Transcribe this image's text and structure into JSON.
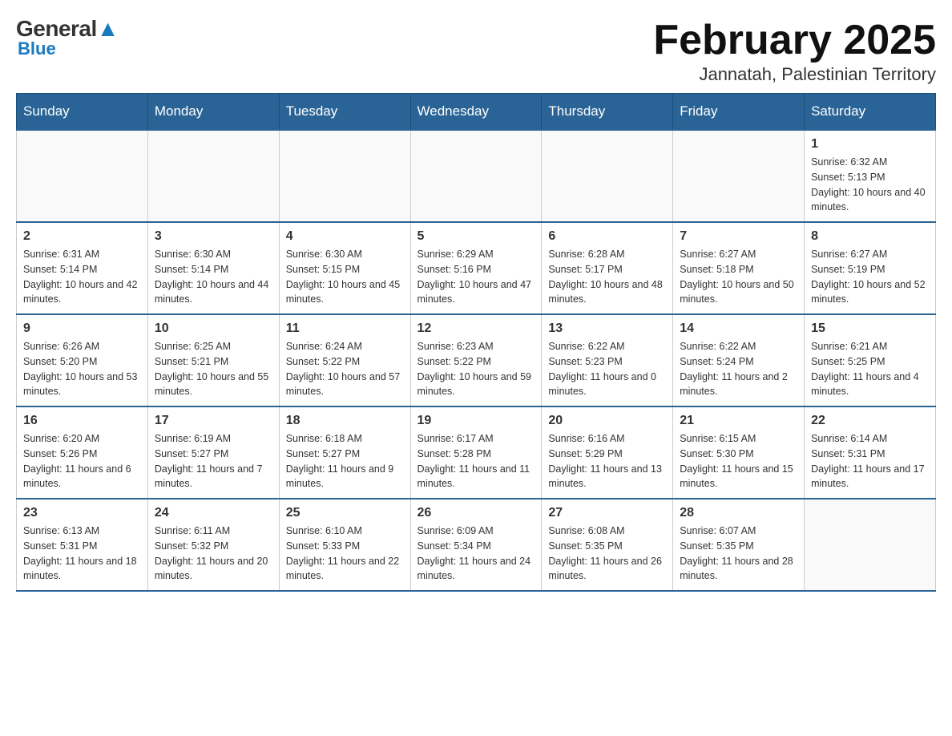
{
  "logo": {
    "general": "General",
    "blue": "Blue",
    "arrow": "▼"
  },
  "header": {
    "month_year": "February 2025",
    "location": "Jannatah, Palestinian Territory"
  },
  "days_of_week": [
    "Sunday",
    "Monday",
    "Tuesday",
    "Wednesday",
    "Thursday",
    "Friday",
    "Saturday"
  ],
  "weeks": [
    [
      {
        "day": "",
        "sunrise": "",
        "sunset": "",
        "daylight": ""
      },
      {
        "day": "",
        "sunrise": "",
        "sunset": "",
        "daylight": ""
      },
      {
        "day": "",
        "sunrise": "",
        "sunset": "",
        "daylight": ""
      },
      {
        "day": "",
        "sunrise": "",
        "sunset": "",
        "daylight": ""
      },
      {
        "day": "",
        "sunrise": "",
        "sunset": "",
        "daylight": ""
      },
      {
        "day": "",
        "sunrise": "",
        "sunset": "",
        "daylight": ""
      },
      {
        "day": "1",
        "sunrise": "Sunrise: 6:32 AM",
        "sunset": "Sunset: 5:13 PM",
        "daylight": "Daylight: 10 hours and 40 minutes."
      }
    ],
    [
      {
        "day": "2",
        "sunrise": "Sunrise: 6:31 AM",
        "sunset": "Sunset: 5:14 PM",
        "daylight": "Daylight: 10 hours and 42 minutes."
      },
      {
        "day": "3",
        "sunrise": "Sunrise: 6:30 AM",
        "sunset": "Sunset: 5:14 PM",
        "daylight": "Daylight: 10 hours and 44 minutes."
      },
      {
        "day": "4",
        "sunrise": "Sunrise: 6:30 AM",
        "sunset": "Sunset: 5:15 PM",
        "daylight": "Daylight: 10 hours and 45 minutes."
      },
      {
        "day": "5",
        "sunrise": "Sunrise: 6:29 AM",
        "sunset": "Sunset: 5:16 PM",
        "daylight": "Daylight: 10 hours and 47 minutes."
      },
      {
        "day": "6",
        "sunrise": "Sunrise: 6:28 AM",
        "sunset": "Sunset: 5:17 PM",
        "daylight": "Daylight: 10 hours and 48 minutes."
      },
      {
        "day": "7",
        "sunrise": "Sunrise: 6:27 AM",
        "sunset": "Sunset: 5:18 PM",
        "daylight": "Daylight: 10 hours and 50 minutes."
      },
      {
        "day": "8",
        "sunrise": "Sunrise: 6:27 AM",
        "sunset": "Sunset: 5:19 PM",
        "daylight": "Daylight: 10 hours and 52 minutes."
      }
    ],
    [
      {
        "day": "9",
        "sunrise": "Sunrise: 6:26 AM",
        "sunset": "Sunset: 5:20 PM",
        "daylight": "Daylight: 10 hours and 53 minutes."
      },
      {
        "day": "10",
        "sunrise": "Sunrise: 6:25 AM",
        "sunset": "Sunset: 5:21 PM",
        "daylight": "Daylight: 10 hours and 55 minutes."
      },
      {
        "day": "11",
        "sunrise": "Sunrise: 6:24 AM",
        "sunset": "Sunset: 5:22 PM",
        "daylight": "Daylight: 10 hours and 57 minutes."
      },
      {
        "day": "12",
        "sunrise": "Sunrise: 6:23 AM",
        "sunset": "Sunset: 5:22 PM",
        "daylight": "Daylight: 10 hours and 59 minutes."
      },
      {
        "day": "13",
        "sunrise": "Sunrise: 6:22 AM",
        "sunset": "Sunset: 5:23 PM",
        "daylight": "Daylight: 11 hours and 0 minutes."
      },
      {
        "day": "14",
        "sunrise": "Sunrise: 6:22 AM",
        "sunset": "Sunset: 5:24 PM",
        "daylight": "Daylight: 11 hours and 2 minutes."
      },
      {
        "day": "15",
        "sunrise": "Sunrise: 6:21 AM",
        "sunset": "Sunset: 5:25 PM",
        "daylight": "Daylight: 11 hours and 4 minutes."
      }
    ],
    [
      {
        "day": "16",
        "sunrise": "Sunrise: 6:20 AM",
        "sunset": "Sunset: 5:26 PM",
        "daylight": "Daylight: 11 hours and 6 minutes."
      },
      {
        "day": "17",
        "sunrise": "Sunrise: 6:19 AM",
        "sunset": "Sunset: 5:27 PM",
        "daylight": "Daylight: 11 hours and 7 minutes."
      },
      {
        "day": "18",
        "sunrise": "Sunrise: 6:18 AM",
        "sunset": "Sunset: 5:27 PM",
        "daylight": "Daylight: 11 hours and 9 minutes."
      },
      {
        "day": "19",
        "sunrise": "Sunrise: 6:17 AM",
        "sunset": "Sunset: 5:28 PM",
        "daylight": "Daylight: 11 hours and 11 minutes."
      },
      {
        "day": "20",
        "sunrise": "Sunrise: 6:16 AM",
        "sunset": "Sunset: 5:29 PM",
        "daylight": "Daylight: 11 hours and 13 minutes."
      },
      {
        "day": "21",
        "sunrise": "Sunrise: 6:15 AM",
        "sunset": "Sunset: 5:30 PM",
        "daylight": "Daylight: 11 hours and 15 minutes."
      },
      {
        "day": "22",
        "sunrise": "Sunrise: 6:14 AM",
        "sunset": "Sunset: 5:31 PM",
        "daylight": "Daylight: 11 hours and 17 minutes."
      }
    ],
    [
      {
        "day": "23",
        "sunrise": "Sunrise: 6:13 AM",
        "sunset": "Sunset: 5:31 PM",
        "daylight": "Daylight: 11 hours and 18 minutes."
      },
      {
        "day": "24",
        "sunrise": "Sunrise: 6:11 AM",
        "sunset": "Sunset: 5:32 PM",
        "daylight": "Daylight: 11 hours and 20 minutes."
      },
      {
        "day": "25",
        "sunrise": "Sunrise: 6:10 AM",
        "sunset": "Sunset: 5:33 PM",
        "daylight": "Daylight: 11 hours and 22 minutes."
      },
      {
        "day": "26",
        "sunrise": "Sunrise: 6:09 AM",
        "sunset": "Sunset: 5:34 PM",
        "daylight": "Daylight: 11 hours and 24 minutes."
      },
      {
        "day": "27",
        "sunrise": "Sunrise: 6:08 AM",
        "sunset": "Sunset: 5:35 PM",
        "daylight": "Daylight: 11 hours and 26 minutes."
      },
      {
        "day": "28",
        "sunrise": "Sunrise: 6:07 AM",
        "sunset": "Sunset: 5:35 PM",
        "daylight": "Daylight: 11 hours and 28 minutes."
      },
      {
        "day": "",
        "sunrise": "",
        "sunset": "",
        "daylight": ""
      }
    ]
  ]
}
